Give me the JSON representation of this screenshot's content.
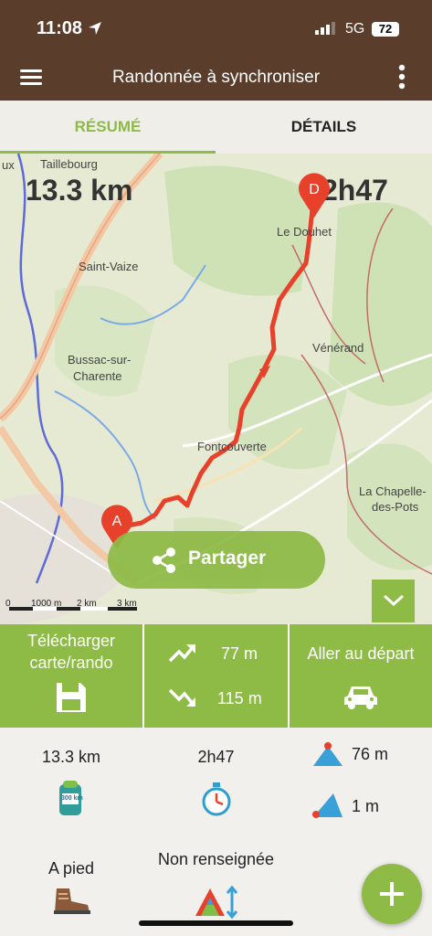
{
  "status": {
    "time": "11:08",
    "network": "5G",
    "battery": "72"
  },
  "appbar": {
    "title": "Randonnée à synchroniser"
  },
  "tabs": [
    {
      "label": "RÉSUMÉ"
    },
    {
      "label": "DÉTAILS"
    }
  ],
  "map": {
    "distance": "13.3 km",
    "duration": "2h47",
    "start_marker": "A",
    "end_marker": "D",
    "places": [
      "Taillebourg",
      "Saint-Vaize",
      "Bussac-sur-",
      "Charente",
      "Le Douhet",
      "Vénérand",
      "Fontcouverte",
      "La Chapelle-",
      "des-Pots",
      "ux"
    ],
    "scale": [
      "0",
      "1000 m",
      "2 km",
      "3 km"
    ],
    "share_label": "Partager"
  },
  "actions": {
    "download_line1": "Télécharger",
    "download_line2": "carte/rando",
    "ascent": "77 m",
    "descent": "115 m",
    "go_start": "Aller au départ"
  },
  "stats": {
    "distance": "13.3 km",
    "duration": "2h47",
    "max_alt": "76 m",
    "min_alt": "1 m",
    "activity": "A pied",
    "difficulty": "Non renseignée",
    "odometer_text": "300 km"
  },
  "colors": {
    "brand": "#5a3d2b",
    "accent": "#8dbb46",
    "route": "#e8412b"
  }
}
